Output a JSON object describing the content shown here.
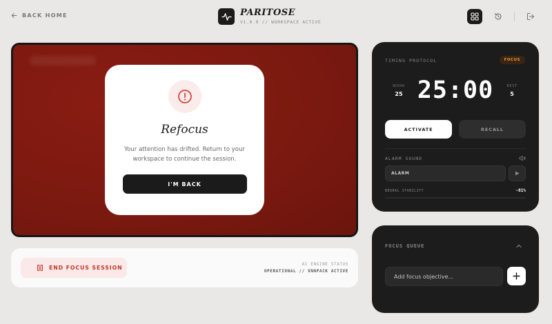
{
  "header": {
    "back_label": "BACK HOME",
    "brand_name": "PARITOSE",
    "brand_subtitle": "V1.0.0 // WORKSPACE ACTIVE",
    "icons": [
      "grid-icon",
      "history-icon",
      "logout-icon"
    ]
  },
  "modal": {
    "title": "Refocus",
    "message": "Your attention has drifted. Return to your workspace to continue the session.",
    "button_label": "I'M BACK"
  },
  "session": {
    "end_label": "END FOCUS SESSION",
    "engine_label": "AI ENGINE STATUS",
    "engine_value": "OPERATIONAL // XNNPACK ACTIVE"
  },
  "timer": {
    "label": "TIMING PROTOCOL",
    "mode_badge": "FOCUS",
    "work_label": "WORK",
    "work_value": "25",
    "rest_label": "REST",
    "rest_value": "5",
    "time": "25:00",
    "activate_label": "ACTIVATE",
    "recall_label": "RECALL",
    "alarm_label": "ALARM SOUND",
    "alarm_value": "ALARM",
    "stability_label": "NEURAL STABILITY",
    "stability_value": "~81%"
  },
  "queue": {
    "label": "FOCUS QUEUE",
    "placeholder": "Add focus objective..."
  },
  "colors": {
    "focus_bg": "#7a1910",
    "accent_red": "#c0392b",
    "badge_orange": "#e59a3c",
    "card_dark": "#1c1c1c"
  }
}
